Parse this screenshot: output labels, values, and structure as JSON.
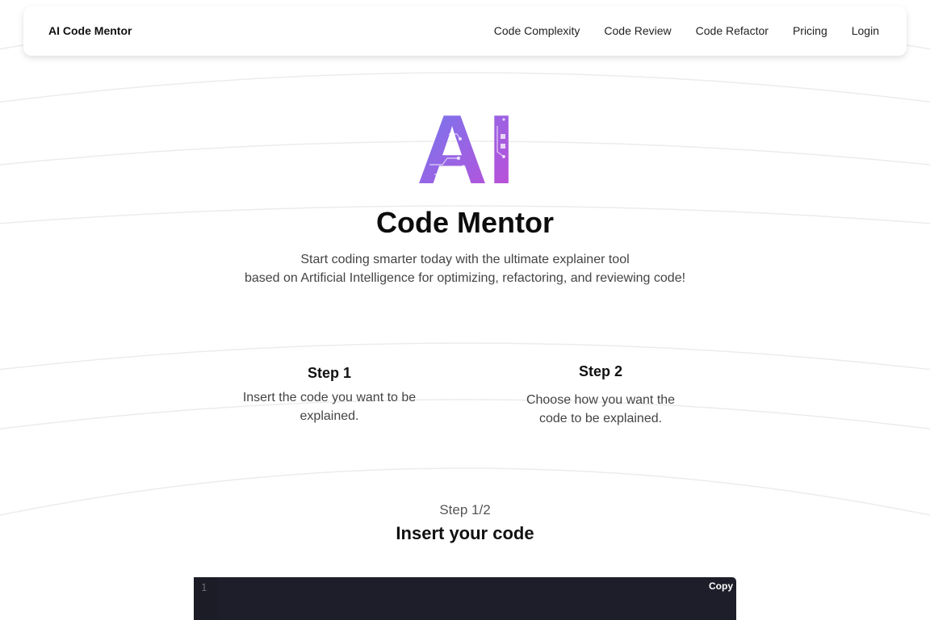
{
  "header": {
    "brand": "AI Code Mentor",
    "nav": [
      {
        "label": "Code Complexity"
      },
      {
        "label": "Code Review"
      },
      {
        "label": "Code Refactor"
      },
      {
        "label": "Pricing"
      },
      {
        "label": "Login"
      }
    ]
  },
  "hero": {
    "logo_text": "AI",
    "title": "Code Mentor",
    "subtitle_line1": "Start coding smarter today with the ultimate explainer tool",
    "subtitle_line2": "based on Artificial Intelligence for optimizing, refactoring, and reviewing code!"
  },
  "steps": [
    {
      "title": "Step 1",
      "text_line1": "Insert the code you want to be",
      "text_line2": "explained."
    },
    {
      "title": "Step 2",
      "text_line1": "Choose how you want the",
      "text_line2": "code to be explained."
    }
  ],
  "section": {
    "progress": "Step 1/2",
    "title": "Insert your code"
  },
  "editor": {
    "line_number": "1",
    "value": "",
    "copy_label": "Copy"
  },
  "colors": {
    "gradient_start": "#6f7cf0",
    "gradient_end": "#c44ad6",
    "editor_bg": "#1e1e2a"
  }
}
